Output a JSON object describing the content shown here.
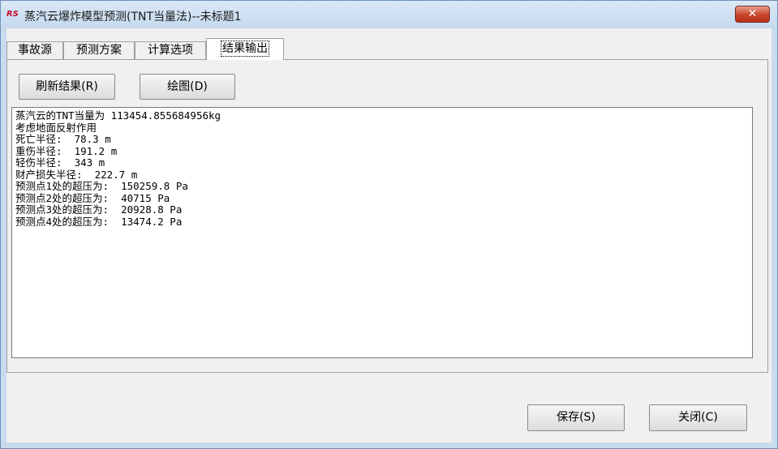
{
  "window": {
    "title": "蒸汽云爆炸模型预测(TNT当量法)--未标题1",
    "app_icon": "RS",
    "close_glyph": "✕"
  },
  "tabs": [
    {
      "label": "事故源"
    },
    {
      "label": "预测方案"
    },
    {
      "label": "计算选项"
    },
    {
      "label": "结果输出",
      "active": true
    }
  ],
  "toolbar": {
    "refresh_label": "刷新结果(R)",
    "plot_label": "绘图(D)"
  },
  "output": {
    "lines": [
      "蒸汽云的TNT当量为 113454.855684956kg",
      "考虑地面反射作用",
      "死亡半径:  78.3 m",
      "重伤半径:  191.2 m",
      "轻伤半径:  343 m",
      "财产损失半径:  222.7 m",
      "预测点1处的超压为:  150259.8 Pa",
      "预测点2处的超压为:  40715 Pa",
      "预测点3处的超压为:  20928.8 Pa",
      "预测点4处的超压为:  13474.2 Pa"
    ]
  },
  "footer": {
    "save_label": "保存(S)",
    "close_label": "关闭(C)"
  },
  "colors": {
    "title_bar": "#c5d9ef",
    "close_button": "#c7432a",
    "dialog_background": "#f0f0f0"
  }
}
